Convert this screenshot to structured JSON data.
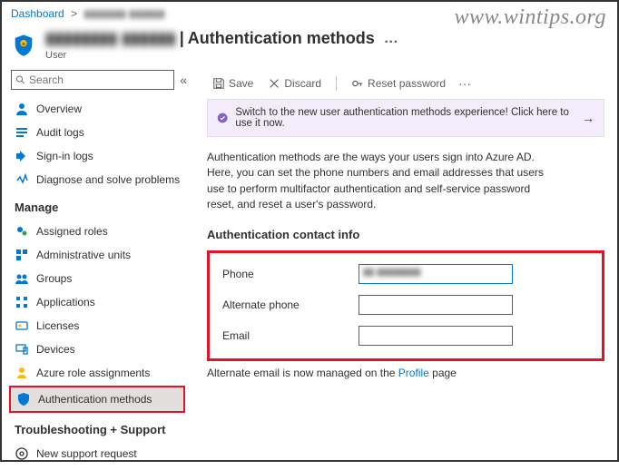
{
  "watermark": "www.wintips.org",
  "breadcrumb": {
    "root": "Dashboard",
    "sep": ">",
    "item": "▮▮▮▮▮▮▮ ▮▮▮▮▮▮"
  },
  "header": {
    "name": "▮▮▮▮▮▮▮▮ ▮▮▮▮▮▮",
    "divider": " | ",
    "title": "Authentication methods",
    "more": "…",
    "subtitle": "User"
  },
  "sidebar": {
    "search_placeholder": "Search",
    "collapse": "«",
    "top": [
      {
        "label": "Overview"
      },
      {
        "label": "Audit logs"
      },
      {
        "label": "Sign-in logs"
      },
      {
        "label": "Diagnose and solve problems"
      }
    ],
    "manage_label": "Manage",
    "manage": [
      {
        "label": "Assigned roles"
      },
      {
        "label": "Administrative units"
      },
      {
        "label": "Groups"
      },
      {
        "label": "Applications"
      },
      {
        "label": "Licenses"
      },
      {
        "label": "Devices"
      },
      {
        "label": "Azure role assignments"
      },
      {
        "label": "Authentication methods"
      }
    ],
    "ts_label": "Troubleshooting + Support",
    "ts": [
      {
        "label": "New support request"
      }
    ]
  },
  "toolbar": {
    "save": "Save",
    "discard": "Discard",
    "reset": "Reset password",
    "more": "···"
  },
  "banner": {
    "text": "Switch to the new user authentication methods experience! Click here to use it now.",
    "arrow": "→"
  },
  "desc": "Authentication methods are the ways your users sign into Azure AD. Here, you can set the phone numbers and email addresses that users use to perform multifactor authentication and self-service password reset, and reset a user's password.",
  "section": "Authentication contact info",
  "form": {
    "phone_label": "Phone",
    "phone_value": "▮▮ ▮▮▮▮▮▮▮▮",
    "alt_label": "Alternate phone",
    "alt_value": "",
    "email_label": "Email",
    "email_value": ""
  },
  "note_pre": "Alternate email is now managed on the ",
  "note_link": "Profile",
  "note_post": " page"
}
